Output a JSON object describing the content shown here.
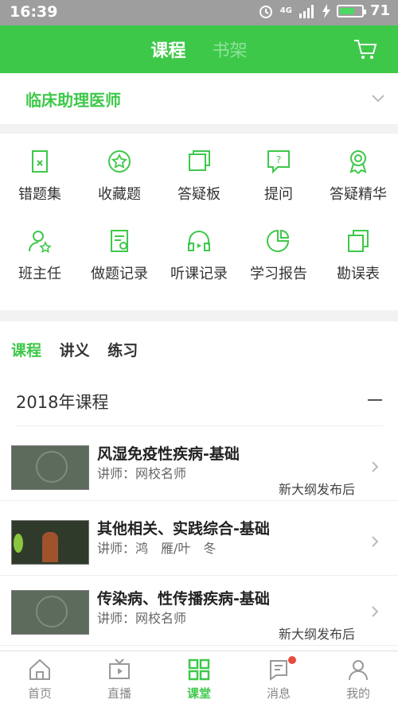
{
  "status": {
    "time": "16:39",
    "net": "4G",
    "battery": "71"
  },
  "top": {
    "tab_active": "课程",
    "tab_inactive": "书架"
  },
  "category": {
    "label": "临床助理医师"
  },
  "tools": [
    {
      "label": "错题集",
      "icon": "wrong-book-icon"
    },
    {
      "label": "收藏题",
      "icon": "star-icon"
    },
    {
      "label": "答疑板",
      "icon": "board-icon"
    },
    {
      "label": "提问",
      "icon": "question-icon"
    },
    {
      "label": "答疑精华",
      "icon": "award-icon"
    },
    {
      "label": "班主任",
      "icon": "teacher-icon"
    },
    {
      "label": "做题记录",
      "icon": "practice-record-icon"
    },
    {
      "label": "听课记录",
      "icon": "headphone-icon"
    },
    {
      "label": "学习报告",
      "icon": "report-icon"
    },
    {
      "label": "勘误表",
      "icon": "copy-icon"
    }
  ],
  "subtabs": [
    "课程",
    "讲义",
    "练习"
  ],
  "year_title": "2018年课程",
  "courses": [
    {
      "title": "风湿免疫性疾病-基础",
      "teacher": "讲师：网校名师",
      "note": "新大纲发布后"
    },
    {
      "title": "其他相关、实践综合-基础",
      "teacher": "讲师：鸿　雁/叶　冬",
      "note": ""
    },
    {
      "title": "传染病、性传播疾病-基础",
      "teacher": "讲师：网校名师",
      "note": "新大纲发布后"
    }
  ],
  "tabbar": [
    "首页",
    "直播",
    "课堂",
    "消息",
    "我的"
  ],
  "colors": {
    "brand": "#3ec84a"
  }
}
